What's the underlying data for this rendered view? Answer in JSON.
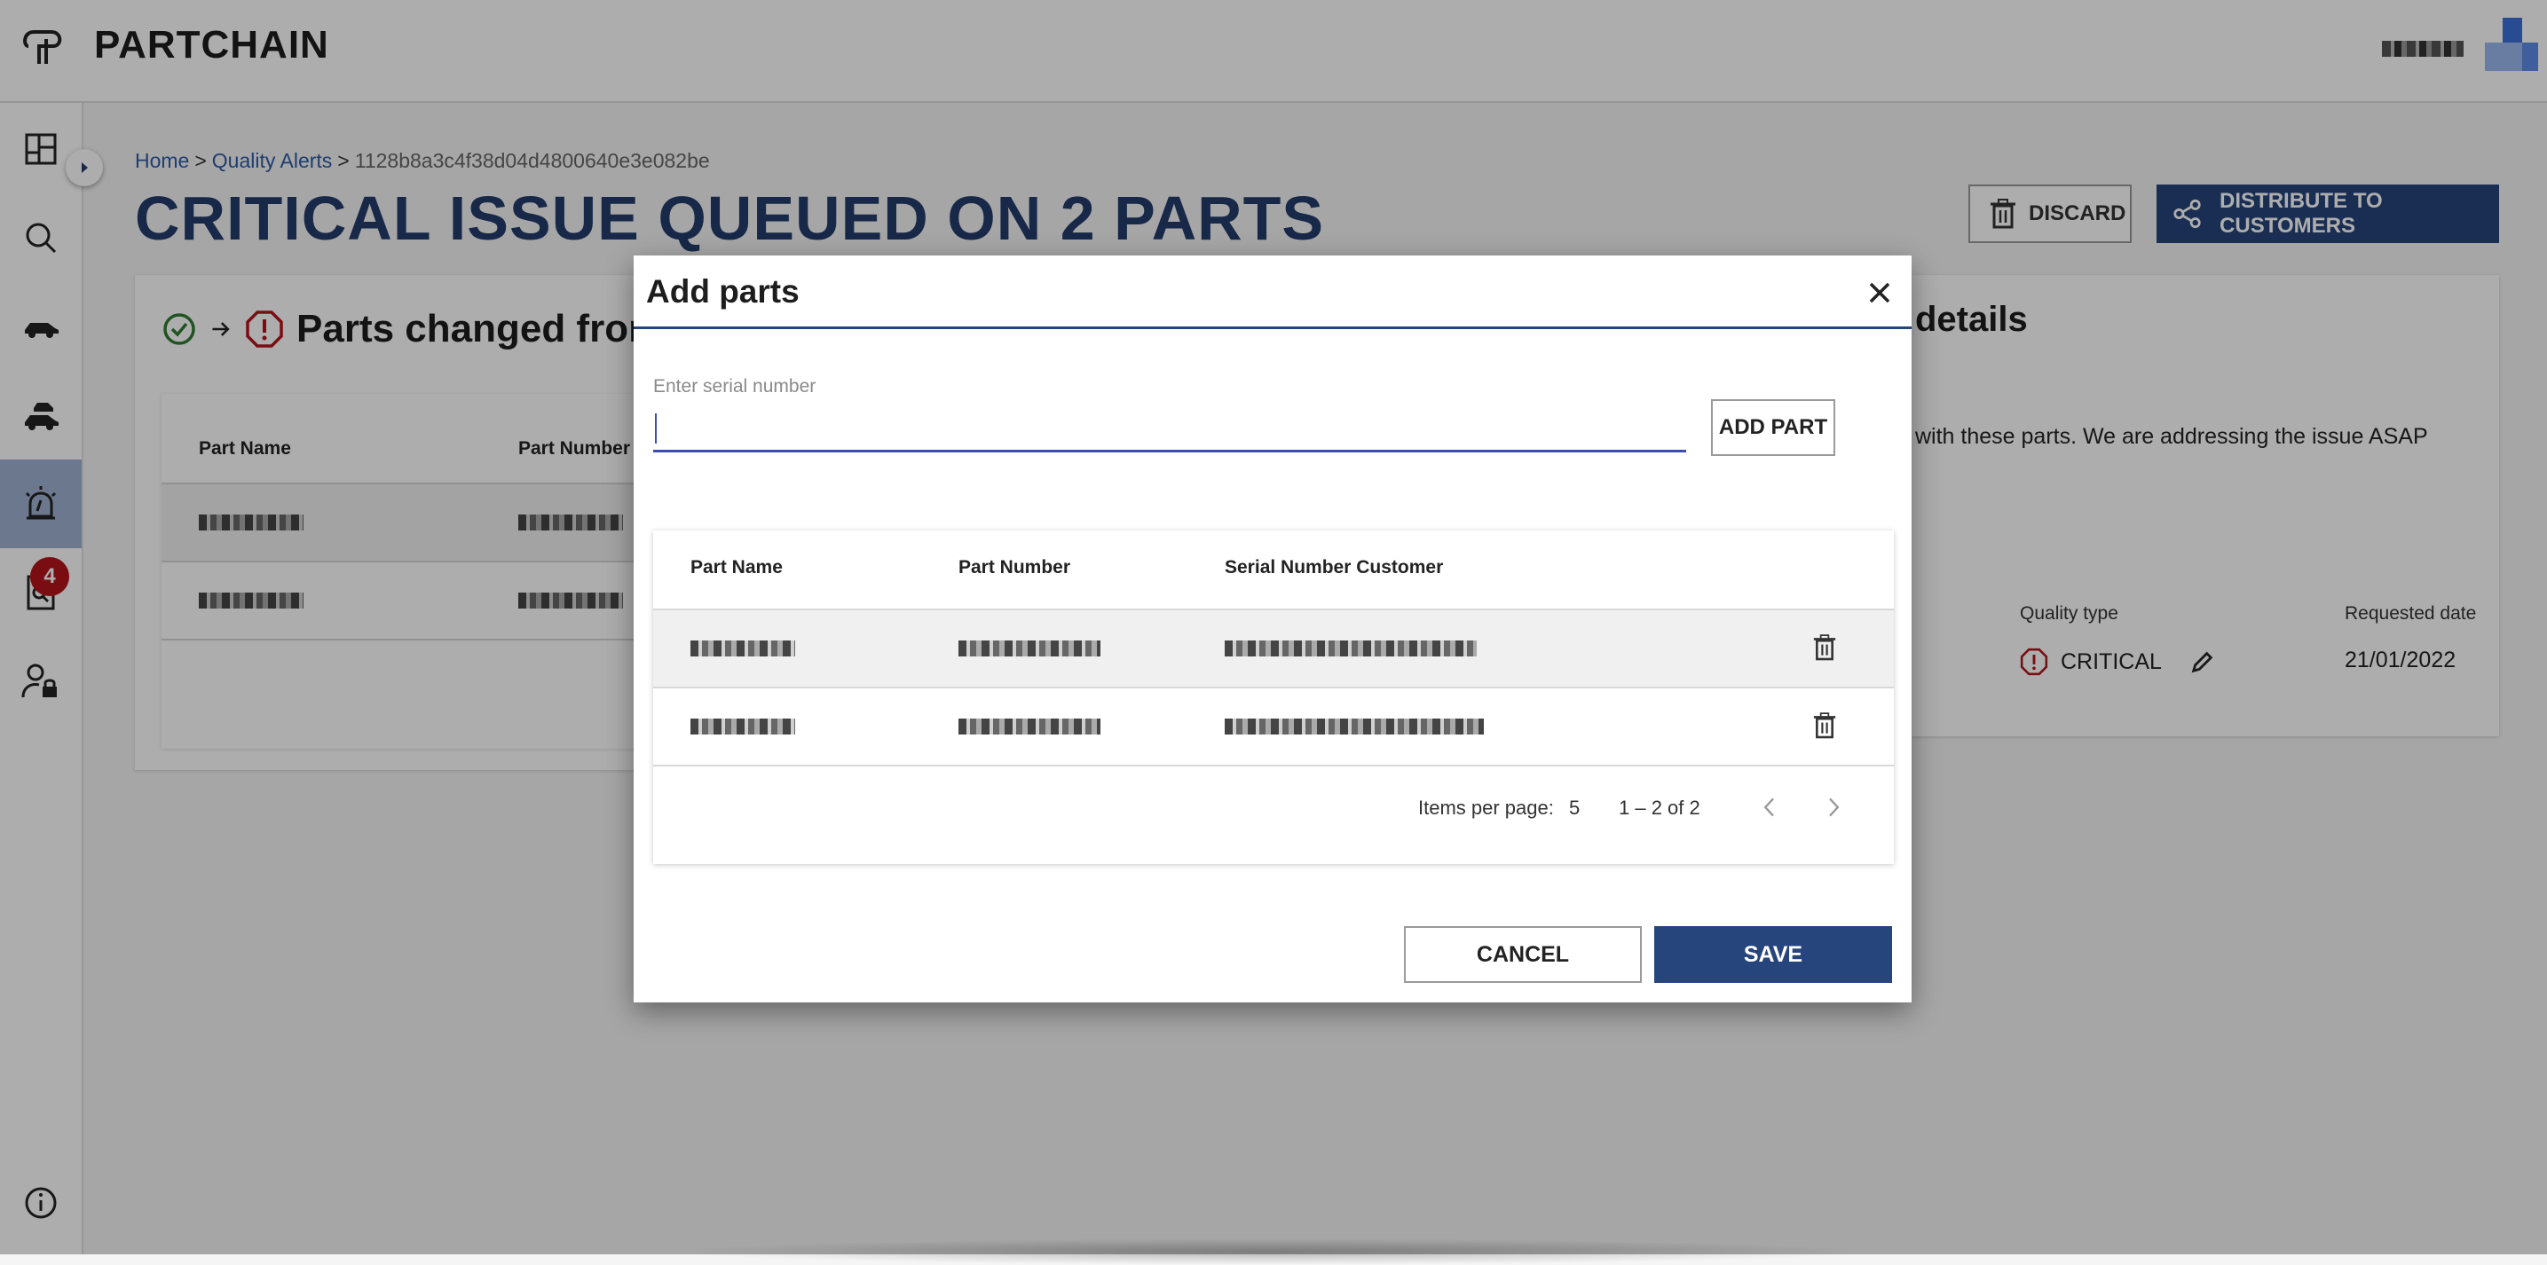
{
  "app": {
    "title": "PARTCHAIN"
  },
  "header": {
    "user_name_blurred": "▓▓▓▓▓▓"
  },
  "sidebar": {
    "items": [
      {
        "name": "dashboard",
        "icon": "dashboard-icon"
      },
      {
        "name": "search",
        "icon": "search-icon"
      },
      {
        "name": "vehicles",
        "icon": "car-icon"
      },
      {
        "name": "other-parts",
        "icon": "cars-icon"
      },
      {
        "name": "quality-alerts",
        "icon": "alarm-icon",
        "active": true
      },
      {
        "name": "quality-investigations",
        "icon": "investigation-icon",
        "badge": "4"
      },
      {
        "name": "admin",
        "icon": "user-lock-icon"
      },
      {
        "name": "about",
        "icon": "info-icon"
      }
    ],
    "badge_count": "4"
  },
  "breadcrumb": {
    "home": "Home",
    "section": "Quality Alerts",
    "current": "1128b8a3c4f38d04d4800640e3e082be",
    "separator": ">"
  },
  "page": {
    "title": "CRITICAL ISSUE QUEUED ON 2 PARTS"
  },
  "actions": {
    "discard": "DISCARD",
    "distribute": "DISTRIBUTE TO CUSTOMERS"
  },
  "affected_parts_card": {
    "title": "Parts changed from OK",
    "columns": [
      "Part Name",
      "Part Number"
    ]
  },
  "details_card": {
    "title": "details",
    "description": "with these parts. We are addressing the issue ASAP",
    "quality_type_label": "Quality type",
    "quality_type_value": "CRITICAL",
    "requested_date_label": "Requested date",
    "requested_date_value": "21/01/2022"
  },
  "dialog": {
    "title": "Add parts",
    "serial_placeholder": "Enter serial number",
    "serial_value": "",
    "add_part_label": "ADD PART",
    "columns": [
      "Part Name",
      "Part Number",
      "Serial Number Customer"
    ],
    "rows": [
      {
        "part_name": "▓▓▓ ▓▓▓▓▓",
        "part_number": "▓▓▓▓▓▓▓",
        "serial": "▓▓▓▓▓▓▓▓▓▓▓▓"
      },
      {
        "part_name": "▓▓▓ ▓▓▓▓▓",
        "part_number": "▓▓▓▓▓▓▓",
        "serial": "▓▓▓▓▓▓▓▓▓▓▓▓"
      }
    ],
    "items_per_page_label": "Items per page:",
    "items_per_page_value": "5",
    "range_label": "1 – 2 of 2",
    "cancel_label": "CANCEL",
    "save_label": "SAVE"
  },
  "colors": {
    "primary": "#27457d",
    "active_nav": "#9fb2d2",
    "critical": "#b3141b",
    "ok": "#2e7d32",
    "input_focus": "#3a4db5"
  }
}
